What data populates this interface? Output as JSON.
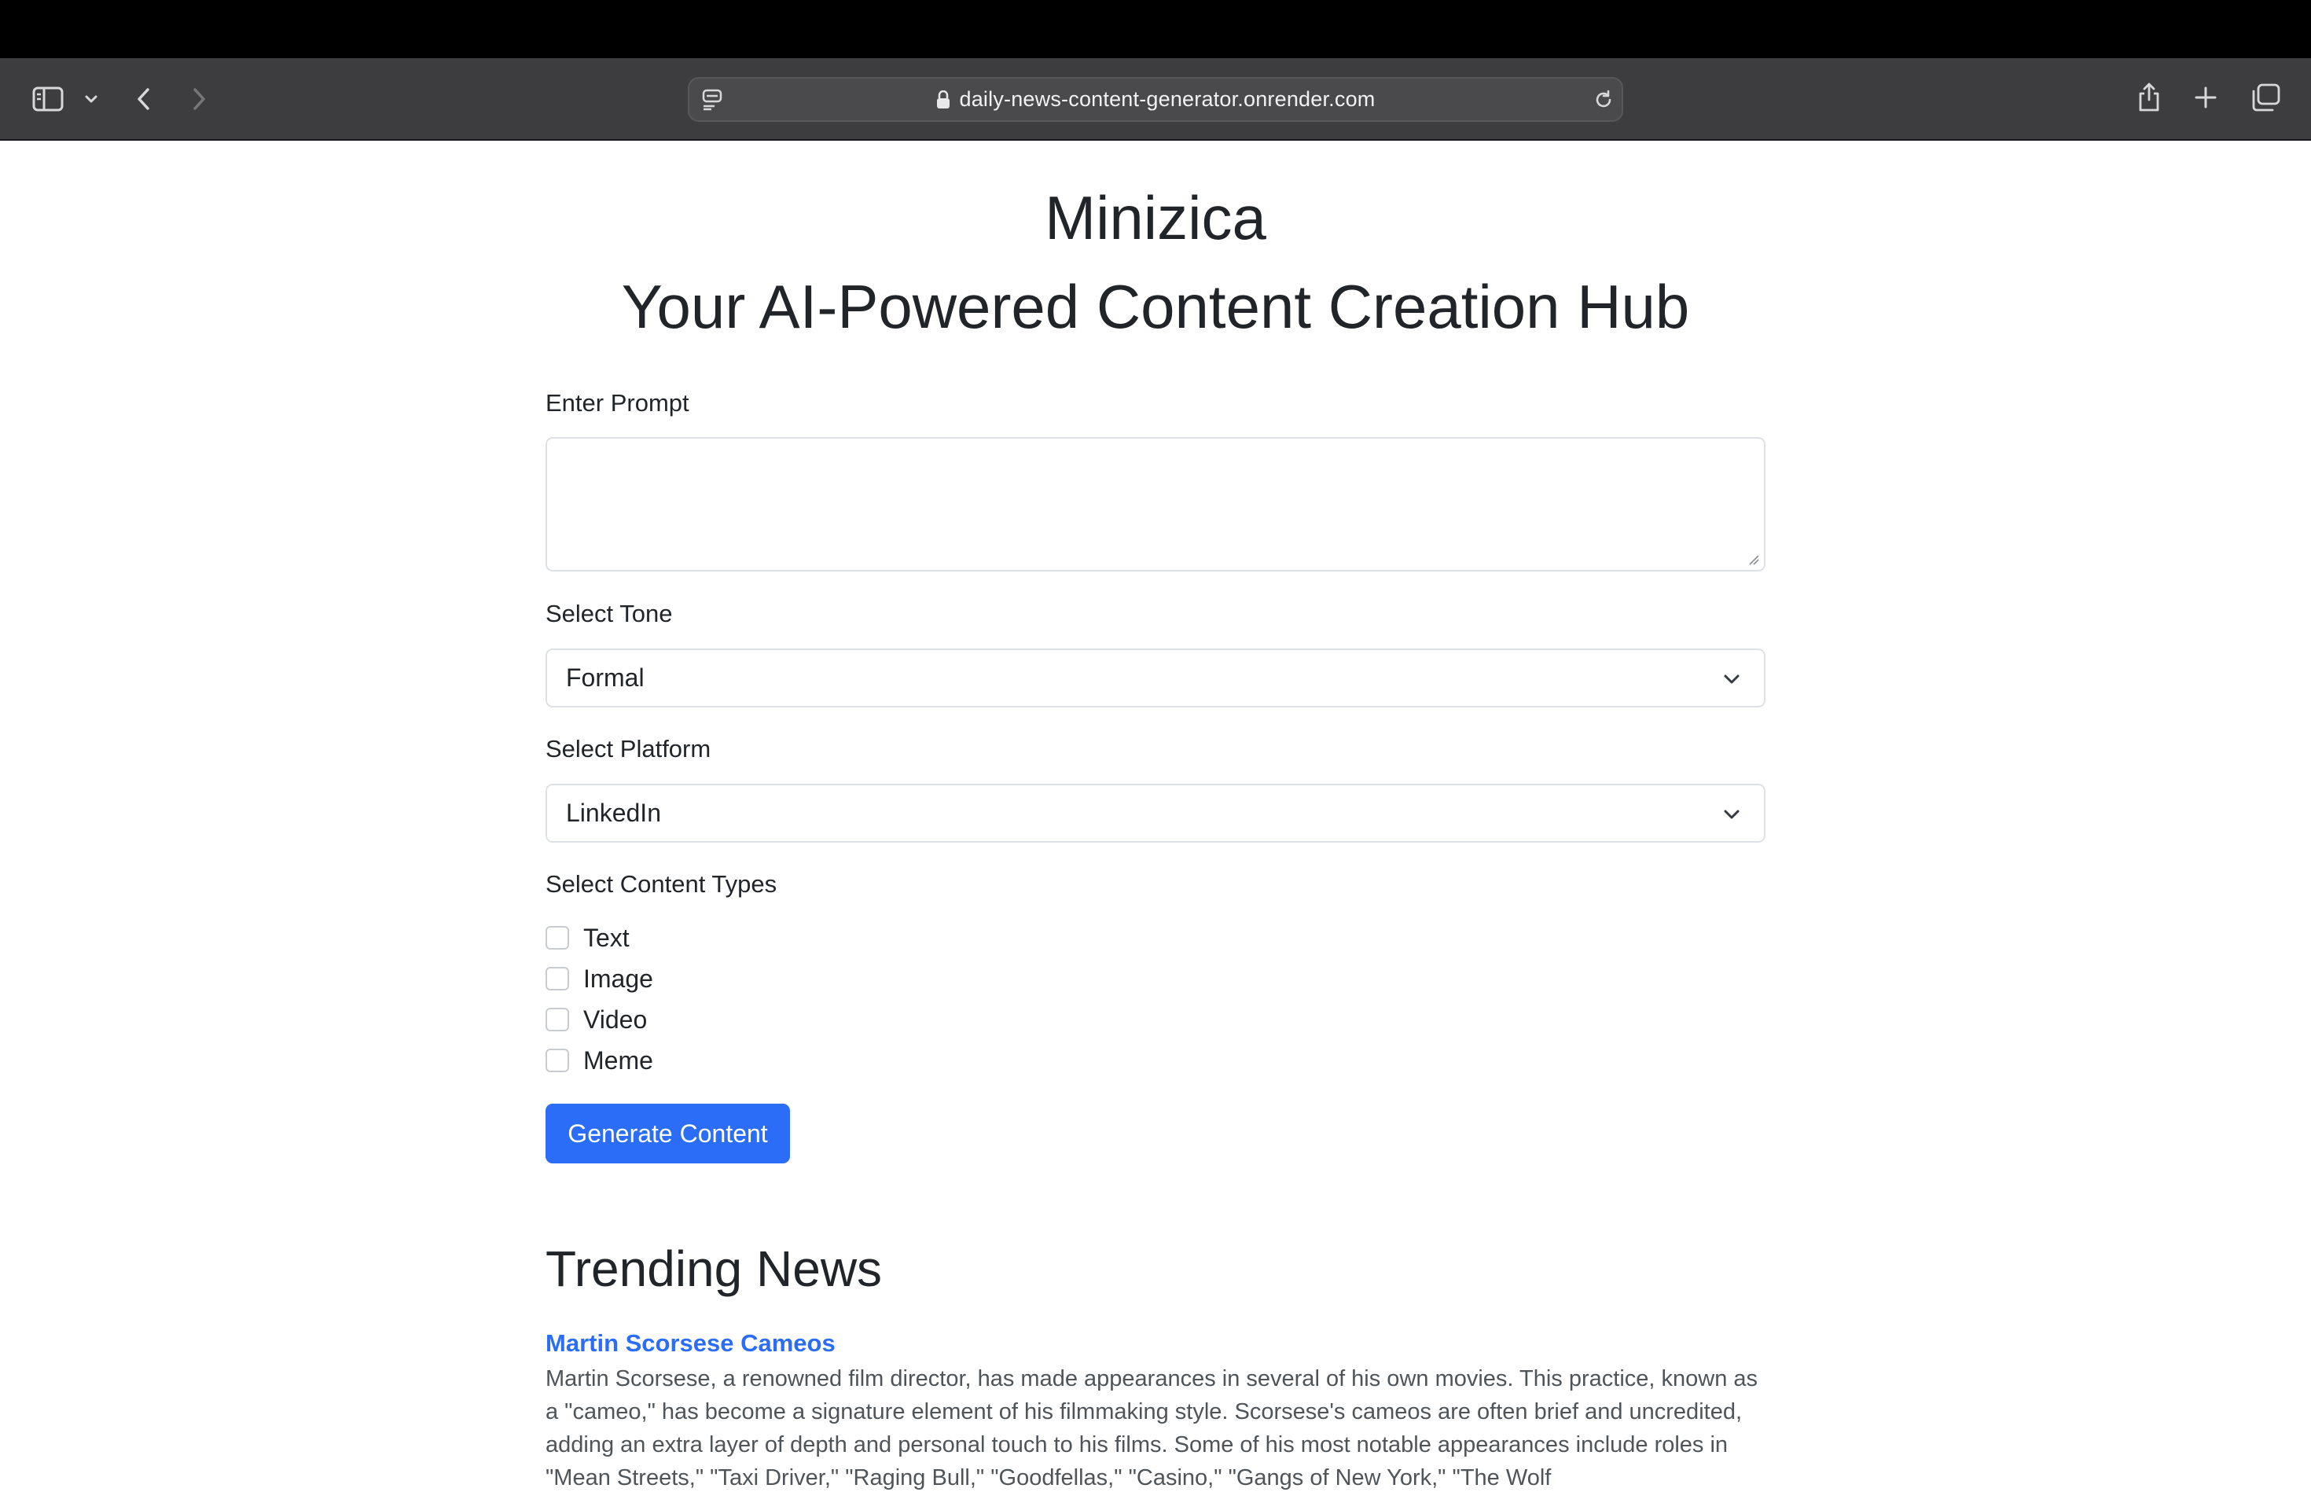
{
  "browser": {
    "url": "daily-news-content-generator.onrender.com",
    "icons": [
      "sidebar-icon",
      "chevron-down-icon",
      "back-icon",
      "forward-icon",
      "page-menu-icon",
      "lock-icon",
      "reload-icon",
      "share-icon",
      "new-tab-icon",
      "tab-overview-icon"
    ]
  },
  "header": {
    "title": "Minizica",
    "subtitle": "Your AI-Powered Content Creation Hub"
  },
  "form": {
    "prompt_label": "Enter Prompt",
    "prompt_value": "",
    "tone_label": "Select Tone",
    "tone_value": "Formal",
    "platform_label": "Select Platform",
    "platform_value": "LinkedIn",
    "content_types_label": "Select Content Types",
    "content_types": [
      {
        "label": "Text",
        "checked": false
      },
      {
        "label": "Image",
        "checked": false
      },
      {
        "label": "Video",
        "checked": false
      },
      {
        "label": "Meme",
        "checked": false
      }
    ],
    "submit_label": "Generate Content"
  },
  "trending": {
    "heading": "Trending News",
    "items": [
      {
        "title": "Martin Scorsese Cameos",
        "body": "Martin Scorsese, a renowned film director, has made appearances in several of his own movies. This practice, known as a \"cameo,\" has become a signature element of his filmmaking style. Scorsese's cameos are often brief and uncredited, adding an extra layer of depth and personal touch to his films. Some of his most notable appearances include roles in \"Mean Streets,\" \"Taxi Driver,\" \"Raging Bull,\" \"Goodfellas,\" \"Casino,\" \"Gangs of New York,\" \"The Wolf"
      }
    ]
  },
  "colors": {
    "primary": "#2b6df6",
    "text": "#212529",
    "muted": "#4f5459",
    "toolbar": "#3d3d3f"
  }
}
